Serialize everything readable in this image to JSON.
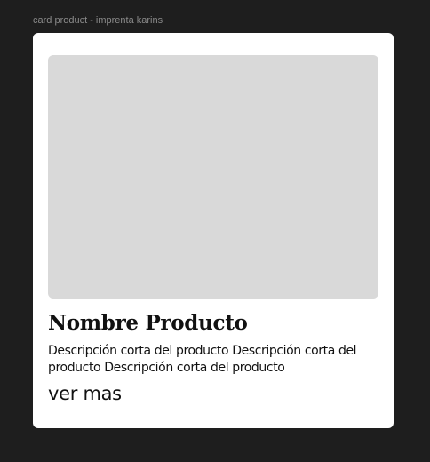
{
  "frame": {
    "label": "card product - imprenta karins"
  },
  "card": {
    "image_placeholder_color": "#d9d9d9",
    "title": "Nombre Producto",
    "description": "Descripción corta del producto Descripción corta del producto Descripción corta del producto",
    "link_label": "ver mas"
  },
  "colors": {
    "canvas_background": "#1e1e1e",
    "card_background": "#ffffff",
    "text": "#111111",
    "frame_label": "#8a8a8a"
  }
}
